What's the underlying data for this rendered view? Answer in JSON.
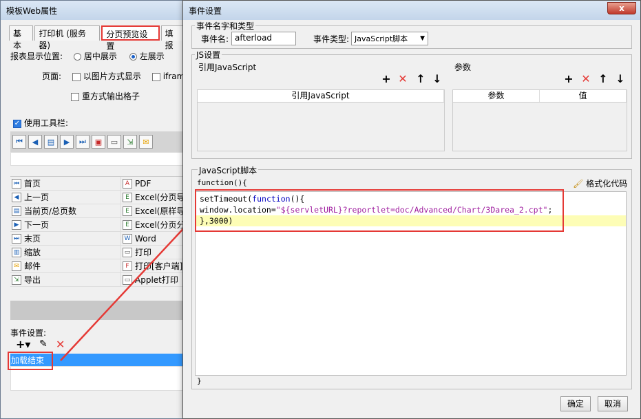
{
  "bg_window": {
    "title": "模板Web属性",
    "tabs": [
      "基本",
      "打印机 (服务器)",
      "分页预览设置",
      "填报"
    ],
    "report_position_label": "报表显示位置:",
    "radio_center": "居中展示",
    "radio_left": "左展示",
    "page_label": "页面:",
    "cb_image_label": "以图片方式显示",
    "cb_iframe_label": "ifram",
    "cb_repeat_label": "重方式输出格子",
    "toolbar_cb_label": "使用工具栏:",
    "buttons_table": [
      {
        "left": "首页",
        "right": "PDF"
      },
      {
        "left": "上一页",
        "right": "Excel(分页导"
      },
      {
        "left": "当前页/总页数",
        "right": "Excel(原样导"
      },
      {
        "left": "下一页",
        "right": "Excel(分页分"
      },
      {
        "left": "末页",
        "right": "Word"
      },
      {
        "left": "缩放",
        "right": "打印"
      },
      {
        "left": "邮件",
        "right": "打印[客户端]"
      },
      {
        "left": "导出",
        "right": "Applet打印"
      }
    ],
    "event_settings_label": "事件设置:",
    "event_item": "加载结束"
  },
  "dialog": {
    "title": "事件设置",
    "close_glyph": "x",
    "name_type_group": "事件名字和类型",
    "event_name_label": "事件名:",
    "event_name_value": "afterload",
    "event_type_label": "事件类型:",
    "event_type_value": "JavaScript脚本",
    "js_group": "JS设置",
    "ref_js_label": "引用JavaScript",
    "params_label": "参数",
    "ref_js_col": "引用JavaScript",
    "param_cols": [
      "参数",
      "值"
    ],
    "script_group": "JavaScript脚本",
    "func_open": "function(){",
    "format_code": "格式化代码",
    "code_line1_a": "setTimeout(",
    "code_line1_kw": "function",
    "code_line1_b": "(){",
    "code_line2_a": "window.location=",
    "code_line2_str": "\"${servletURL}?reportlet=doc/Advanced/Chart/3Darea_2.cpt\"",
    "code_line2_b": ";",
    "code_line3": "},3000)",
    "func_close": "}",
    "ok": "确定",
    "cancel": "取消"
  },
  "colors": {
    "accent_red": "#e53935",
    "keyword_blue": "#0000c0",
    "string_purple": "#a020a0"
  }
}
